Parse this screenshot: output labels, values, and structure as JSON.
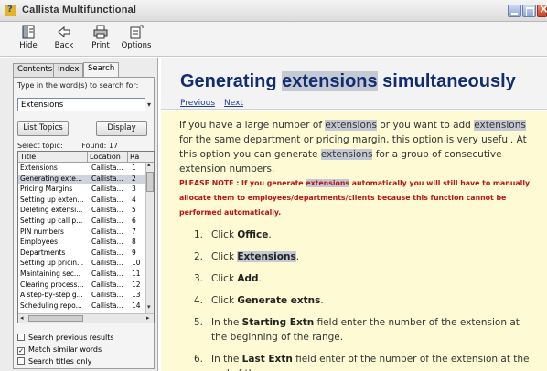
{
  "window": {
    "title": "Callista Multifunctional"
  },
  "toolbar": {
    "items": [
      {
        "label": "Hide",
        "icon": "hide-icon"
      },
      {
        "label": "Back",
        "icon": "back-arrow-icon"
      },
      {
        "label": "Print",
        "icon": "printer-icon"
      },
      {
        "label": "Options",
        "icon": "options-icon"
      }
    ]
  },
  "sidebar": {
    "tabs": [
      "Contents",
      "Index",
      "Search"
    ],
    "active_tab": "Search",
    "prompt": "Type in the word(s) to search for:",
    "search_value": "Extensions",
    "list_topics_label": "List Topics",
    "display_label": "Display",
    "select_topic_label": "Select topic:",
    "found_label": "Found: 17",
    "columns": [
      "Title",
      "Location",
      "Ra"
    ],
    "rows": [
      {
        "title": "Extensions",
        "location": "Callista...",
        "rank": "1"
      },
      {
        "title": "Generating exte...",
        "location": "Callista...",
        "rank": "2"
      },
      {
        "title": "Pricing Margins",
        "location": "Callista...",
        "rank": "3"
      },
      {
        "title": "Setting up exten...",
        "location": "Callista...",
        "rank": "4"
      },
      {
        "title": "Deleting extensi...",
        "location": "Callista...",
        "rank": "5"
      },
      {
        "title": "Setting up call p...",
        "location": "Callista...",
        "rank": "6"
      },
      {
        "title": "PIN numbers",
        "location": "Callista...",
        "rank": "7"
      },
      {
        "title": "Employees",
        "location": "Callista...",
        "rank": "8"
      },
      {
        "title": "Departments",
        "location": "Callista...",
        "rank": "9"
      },
      {
        "title": "Setting up pricin...",
        "location": "Callista...",
        "rank": "10"
      },
      {
        "title": "Maintaining sec...",
        "location": "Callista...",
        "rank": "11"
      },
      {
        "title": "Clearing process...",
        "location": "Callista...",
        "rank": "12"
      },
      {
        "title": "A step-by-step g...",
        "location": "Callista...",
        "rank": "13"
      },
      {
        "title": "Scheduling repo...",
        "location": "Callista...",
        "rank": "14"
      }
    ],
    "selected_row": 1,
    "options": [
      {
        "label": "Search previous results",
        "checked": false
      },
      {
        "label": "Match similar words",
        "checked": true
      },
      {
        "label": "Search titles only",
        "checked": false
      }
    ]
  },
  "content": {
    "title_pre": "Generating ",
    "title_hl": "extensions",
    "title_post": " simultaneously",
    "nav_previous": "Previous",
    "nav_next": "Next",
    "para": {
      "a": "If you have a large number of ",
      "hl1": "extensions",
      "b": " or you want to add ",
      "hl2": "extensions",
      "c": " for the same department or pricing margin, this option is very useful.  At this option you can generate ",
      "hl3": "extensions",
      "d": " for a group of consecutive extension numbers."
    },
    "note": {
      "a": "PLEASE NOTE : If you generate ",
      "hl": "extensions",
      "b": " automatically you will still have to manually allocate them to employees/departments/clients because this function cannot be performed automatically."
    },
    "steps": [
      {
        "num": "1.",
        "pre": "Click ",
        "bold": "Office",
        "post": "."
      },
      {
        "num": "2.",
        "pre": "Click ",
        "bold": "Extensions",
        "post": "."
      },
      {
        "num": "3.",
        "pre": "Click ",
        "bold": "Add",
        "post": "."
      },
      {
        "num": "4.",
        "pre": "Click ",
        "bold": "Generate extns",
        "post": "."
      },
      {
        "num": "5.",
        "pre": "In the ",
        "bold": "Starting Extn",
        "post": " field enter the number of the extension at the beginning of the range."
      },
      {
        "num": "6.",
        "pre": "In the ",
        "bold": "Last Extn",
        "post": " field enter of the number of the extension at the end of the range."
      }
    ]
  },
  "colors": {
    "title_blue": "#102d72",
    "link_blue": "#1c3fa0",
    "note_red": "#b81515",
    "content_bg": "#fefbd4",
    "highlight": "#c5c9d3"
  }
}
